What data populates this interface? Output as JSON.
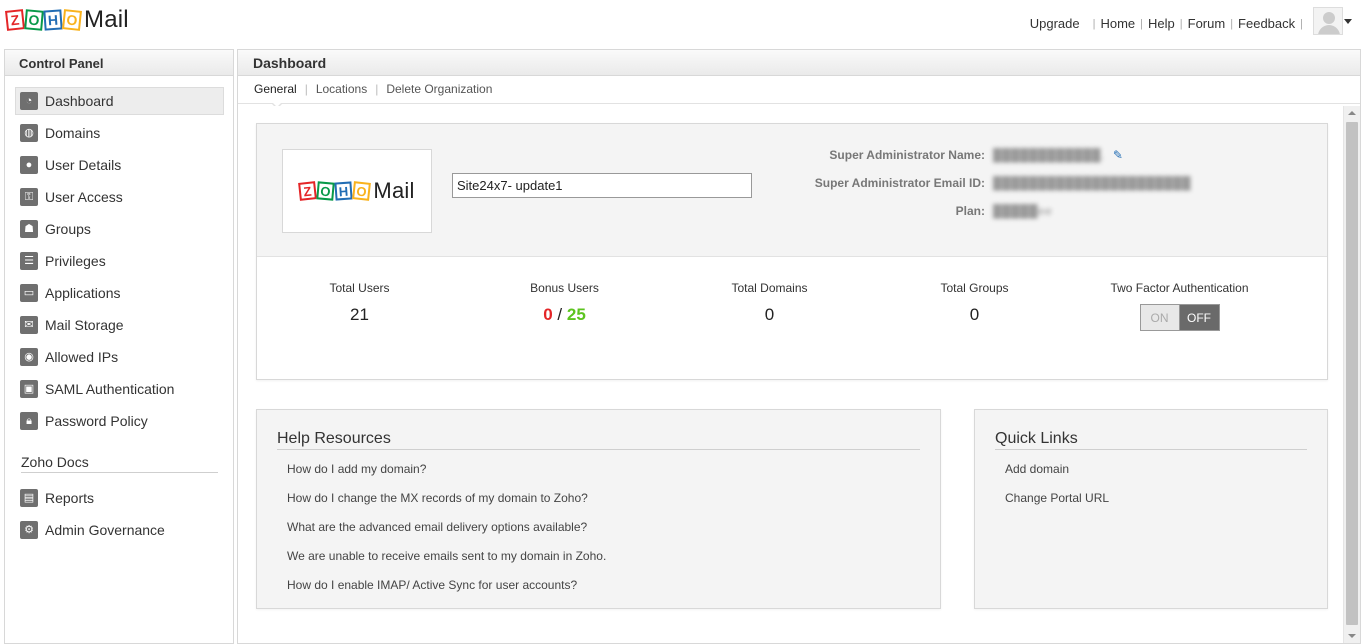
{
  "header": {
    "brand": {
      "letters": [
        "Z",
        "O",
        "H",
        "O"
      ],
      "name": "Mail"
    },
    "links": {
      "upgrade": "Upgrade",
      "home": "Home",
      "help": "Help",
      "forum": "Forum",
      "feedback": "Feedback"
    },
    "separator": "|",
    "avatar_icon": "user-avatar-icon"
  },
  "sidebar": {
    "title": "Control Panel",
    "items": [
      {
        "label": "Dashboard",
        "icon": "dashboard-icon",
        "active": true
      },
      {
        "label": "Domains",
        "icon": "domains-icon"
      },
      {
        "label": "User Details",
        "icon": "user-details-icon"
      },
      {
        "label": "User Access",
        "icon": "user-access-icon"
      },
      {
        "label": "Groups",
        "icon": "groups-icon"
      },
      {
        "label": "Privileges",
        "icon": "privileges-icon"
      },
      {
        "label": "Applications",
        "icon": "applications-icon"
      },
      {
        "label": "Mail Storage",
        "icon": "mail-storage-icon"
      },
      {
        "label": "Allowed IPs",
        "icon": "allowed-ips-icon"
      },
      {
        "label": "SAML Authentication",
        "icon": "saml-icon"
      },
      {
        "label": "Password Policy",
        "icon": "lock-icon"
      }
    ],
    "section2": {
      "title": "Zoho Docs",
      "items": [
        {
          "label": "Reports",
          "icon": "reports-icon"
        },
        {
          "label": "Admin Governance",
          "icon": "admin-governance-icon"
        }
      ]
    }
  },
  "main": {
    "title": "Dashboard",
    "tabs": [
      {
        "label": "General",
        "active": true
      },
      {
        "label": "Locations"
      },
      {
        "label": "Delete Organization"
      }
    ],
    "org": {
      "name_value": "Site24x7- update1",
      "super_admin_name_label": "Super Administrator Name:",
      "super_admin_name_value": "████████████.",
      "super_admin_email_label": "Super Administrator Email ID:",
      "super_admin_email_value": "██████████████████████",
      "plan_label": "Plan:",
      "plan_value": "█████ee"
    },
    "stats": {
      "total_users": {
        "label": "Total Users",
        "value": "21"
      },
      "bonus_users": {
        "label": "Bonus Users",
        "used": "0",
        "sep": "/",
        "total": "25"
      },
      "total_domains": {
        "label": "Total Domains",
        "value": "0"
      },
      "total_groups": {
        "label": "Total Groups",
        "value": "0"
      },
      "two_factor": {
        "label": "Two Factor Authentication",
        "on_label": "ON",
        "off_label": "OFF",
        "state": "off"
      }
    },
    "help_resources": {
      "title": "Help Resources",
      "links": [
        "How do I add my domain?",
        "How do I change the MX records of my domain to Zoho?",
        "What are the advanced email delivery options available?",
        "We are unable to receive emails sent to my domain in Zoho.",
        "How do I enable IMAP/ Active Sync for user accounts?"
      ]
    },
    "quick_links": {
      "title": "Quick Links",
      "links": [
        "Add domain",
        "Change Portal URL"
      ]
    }
  },
  "colors": {
    "zoho_red": "#e42527",
    "zoho_green": "#089949",
    "zoho_blue": "#226db4",
    "zoho_yellow": "#f9b21d",
    "bonus_used": "#e42527",
    "bonus_total": "#5cc41f"
  }
}
